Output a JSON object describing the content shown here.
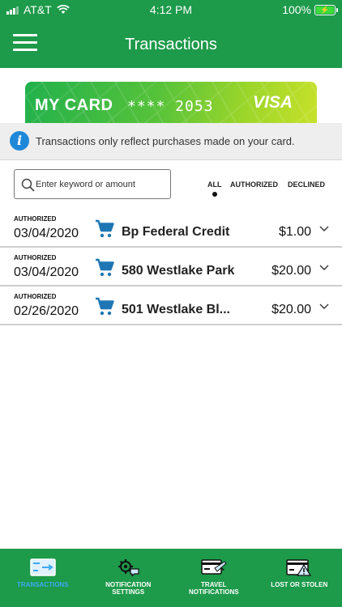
{
  "status_bar": {
    "carrier": "AT&T",
    "time": "4:12 PM",
    "battery": "100%",
    "battery_level": 1.0
  },
  "header": {
    "title": "Transactions",
    "menu_icon": "hamburger-menu-icon"
  },
  "card": {
    "name": "MY CARD",
    "number": "**** 2053",
    "brand": "VISA"
  },
  "banner": {
    "icon": "info-icon",
    "text": "Transactions only reflect purchases made on your card."
  },
  "search": {
    "placeholder": "Enter keyword or amount",
    "value": ""
  },
  "filters": [
    {
      "label": "ALL",
      "selected": true
    },
    {
      "label": "AUTHORIZED",
      "selected": false
    },
    {
      "label": "DECLINED",
      "selected": false
    }
  ],
  "transactions": [
    {
      "status": "AUTHORIZED",
      "date": "03/04/2020",
      "merchant": "Bp Federal Credit",
      "amount": "$1.00",
      "icon": "cart-icon"
    },
    {
      "status": "AUTHORIZED",
      "date": "03/04/2020",
      "merchant": "580 Westlake Park",
      "amount": "$20.00",
      "icon": "cart-icon"
    },
    {
      "status": "AUTHORIZED",
      "date": "02/26/2020",
      "merchant": "501 Westlake Bl...",
      "amount": "$20.00",
      "icon": "cart-icon"
    }
  ],
  "bottom_nav": [
    {
      "label": "TRANSACTIONS",
      "icon": "card-transfer-icon",
      "active": true
    },
    {
      "label": "NOTIFICATION\nSETTINGS",
      "icon": "notification-gear-icon",
      "active": false
    },
    {
      "label": "TRAVEL\nNOTIFICATIONS",
      "icon": "card-airplane-icon",
      "active": false
    },
    {
      "label": "LOST OR STOLEN",
      "icon": "card-warning-icon",
      "active": false
    }
  ],
  "colors": {
    "brand_green": "#1d9a4a",
    "action_blue": "#1f76b4",
    "active_nav": "#3fa9f5"
  }
}
